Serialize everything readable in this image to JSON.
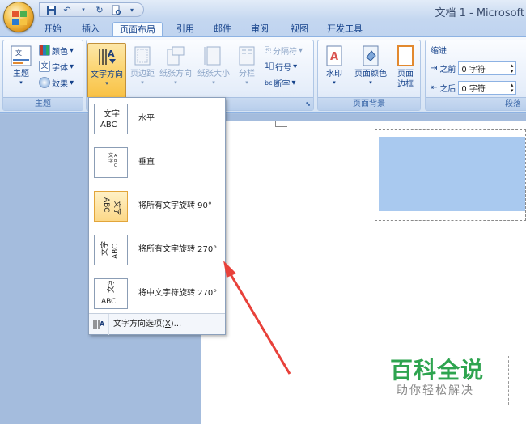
{
  "window": {
    "title": "文档 1 - Microsoft"
  },
  "tabs": [
    {
      "label": "开始",
      "active": false
    },
    {
      "label": "插入",
      "active": false
    },
    {
      "label": "页面布局",
      "active": true
    },
    {
      "label": "引用",
      "active": false
    },
    {
      "label": "邮件",
      "active": false
    },
    {
      "label": "审阅",
      "active": false
    },
    {
      "label": "视图",
      "active": false
    },
    {
      "label": "开发工具",
      "active": false
    }
  ],
  "ribbon": {
    "theme_group": {
      "label": "主题",
      "theme_button": "主题",
      "colors": "颜色",
      "fonts": "字体",
      "effects": "效果"
    },
    "page_setup_group": {
      "text_direction": "文字方向",
      "margins": "页边距",
      "orientation": "纸张方向",
      "size": "纸张大小",
      "columns": "分栏",
      "breaks": "分隔符",
      "line_numbers": "行号",
      "hyphenation": "断字"
    },
    "page_background_group": {
      "label": "页面背景",
      "watermark": "水印",
      "page_color": "页面颜色",
      "page_borders_line1": "页面",
      "page_borders_line2": "边框"
    },
    "paragraph_group": {
      "label": "段落",
      "indent_label": "缩进",
      "before_label": "之前",
      "before_value": "0 字符",
      "after_label": "之后",
      "after_value": "0 字符"
    }
  },
  "text_direction_menu": {
    "items": [
      {
        "label": "水平",
        "thumb": "文字\nABC"
      },
      {
        "label": "垂直",
        "thumb": "vertical"
      },
      {
        "label": "将所有文字旋转 90°",
        "thumb": "rot90",
        "highlighted": true
      },
      {
        "label": "将所有文字旋转 270°",
        "thumb": "rot270"
      },
      {
        "label": "将中文字符旋转 270°",
        "thumb": "cjk270"
      }
    ],
    "footer_prefix": "文字方向选项(",
    "footer_key": "X",
    "footer_suffix": ")..."
  },
  "watermark": {
    "title": "百科全说",
    "subtitle": "助你轻松解决"
  },
  "colors": {
    "annotation_arrow": "#e8413a",
    "watermark_green": "#2ea44f"
  }
}
